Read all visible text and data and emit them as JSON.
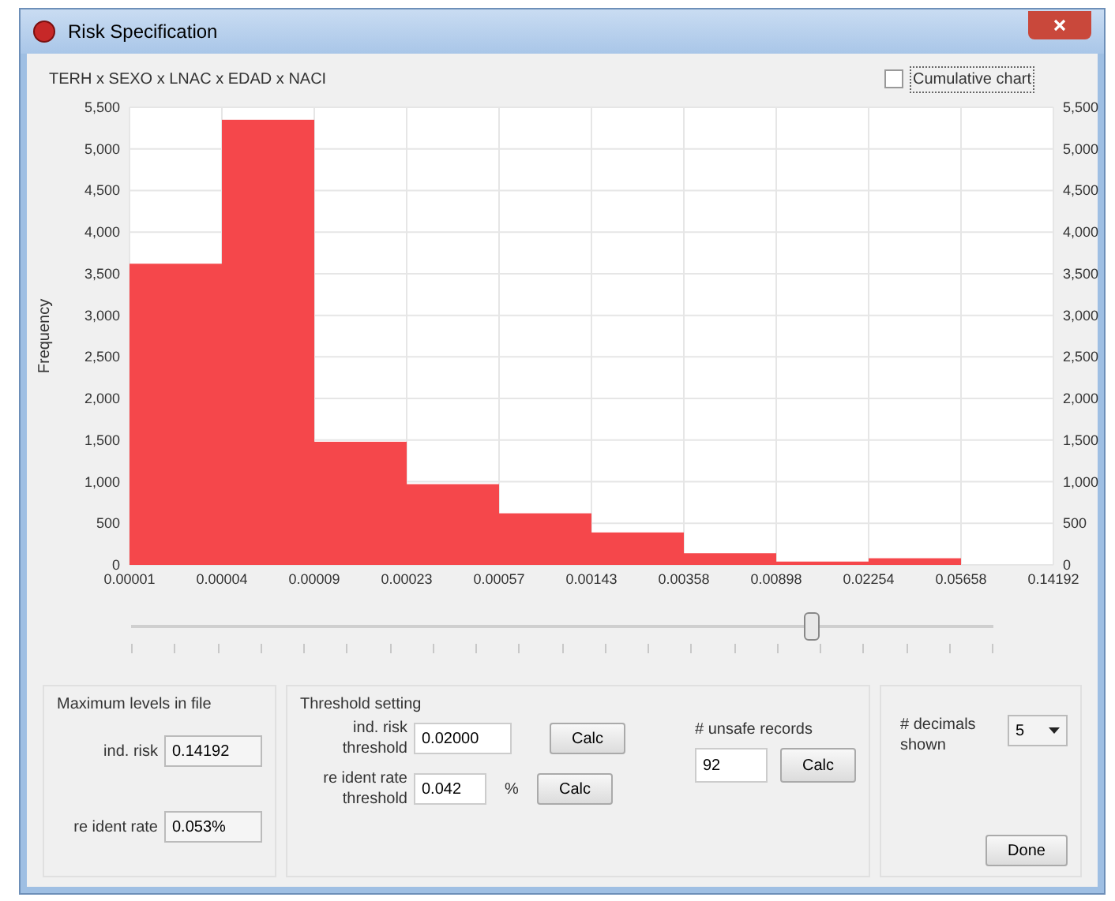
{
  "window": {
    "title": "Risk Specification"
  },
  "chart_title": "TERH x SEXO x LNAC x EDAD x NACI",
  "cumulative": {
    "label": "Cumulative chart",
    "checked": false
  },
  "chart": {
    "chart_data": {
      "type": "bar",
      "ylabel": "Frequency",
      "categories": [
        "0.00001",
        "0.00004",
        "0.00009",
        "0.00023",
        "0.00057",
        "0.00143",
        "0.00358",
        "0.00898",
        "0.02254",
        "0.05658",
        "0.14192"
      ],
      "series": [
        {
          "color": "#f5474b",
          "values": [
            3620,
            5350,
            1480,
            970,
            620,
            390,
            140,
            40,
            80,
            0,
            null
          ]
        }
      ],
      "ylim": [
        0,
        5500
      ],
      "grid": true,
      "yticks": [
        {
          "value": 0,
          "label": "0"
        },
        {
          "value": 500,
          "label": "500"
        },
        {
          "value": 1000,
          "label": "1,000"
        },
        {
          "value": 1500,
          "label": "1,500"
        },
        {
          "value": 2000,
          "label": "2,000"
        },
        {
          "value": 2500,
          "label": "2,500"
        },
        {
          "value": 3000,
          "label": "3,000"
        },
        {
          "value": 3500,
          "label": "3,500"
        },
        {
          "value": 4000,
          "label": "4,000"
        },
        {
          "value": 4500,
          "label": "4,500"
        },
        {
          "value": 5000,
          "label": "5,000"
        },
        {
          "value": 5500,
          "label": "5,500"
        }
      ]
    }
  },
  "slider": {
    "level": 0.79
  },
  "max_levels": {
    "title": "Maximum levels in file",
    "ind_risk_label": "ind. risk",
    "ind_risk": "0.14192",
    "reident_label": "re ident rate",
    "reident": "0.053%"
  },
  "threshold": {
    "title": "Threshold setting",
    "ind_label": "ind. risk threshold",
    "ind_value": "0.02000",
    "ind_button": "Calc",
    "rate_label": "re ident rate threshold",
    "rate_value": "0.042",
    "rate_unit": "%",
    "rate_button": "Calc"
  },
  "unsafe": {
    "label": "# unsafe records",
    "value": "92",
    "button": "Calc"
  },
  "decimals": {
    "label": "# decimals shown",
    "value": "5"
  },
  "done_button": "Done"
}
